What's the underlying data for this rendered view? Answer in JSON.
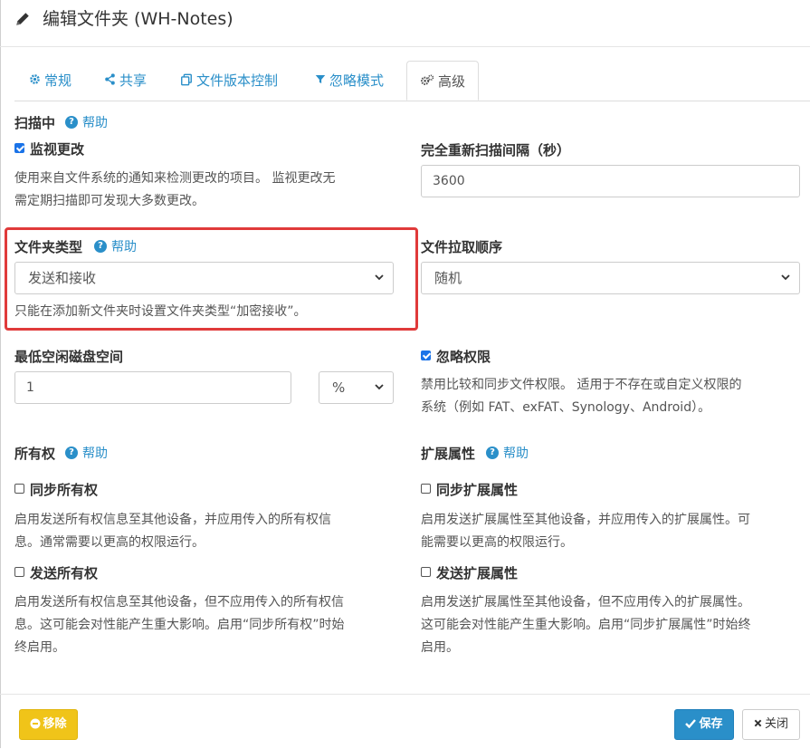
{
  "dialog": {
    "title": "编辑文件夹 (WH-Notes)"
  },
  "tabs": [
    {
      "label": "常规",
      "icon": "gear-icon"
    },
    {
      "label": "共享",
      "icon": "share-icon"
    },
    {
      "label": "文件版本控制",
      "icon": "copy-icon"
    },
    {
      "label": "忽略模式",
      "icon": "filter-icon"
    },
    {
      "label": "高级",
      "icon": "gears-icon",
      "active": true
    }
  ],
  "help_label": "帮助",
  "scanning": {
    "heading": "扫描中",
    "watch_label": "监视更改",
    "watch_checked": true,
    "watch_desc_line1": "使用来自文件系统的通知来检测更改的项目。 监视更改无",
    "watch_desc_line2": "需定期扫描即可发现大多数更改。",
    "rescan_label": "完全重新扫描间隔（秒）",
    "rescan_value": "3600"
  },
  "folder_type": {
    "label": "文件夹类型",
    "selected": "发送和接收",
    "note": "只能在添加新文件夹时设置文件夹类型“加密接收”。"
  },
  "pull_order": {
    "label": "文件拉取顺序",
    "selected": "随机"
  },
  "min_disk": {
    "label": "最低空闲磁盘空间",
    "value": "1",
    "unit": "%"
  },
  "ignore_perms": {
    "label": "忽略权限",
    "checked": true,
    "desc_line1": "禁用比较和同步文件权限。 适用于不存在或自定义权限的",
    "desc_line2": "系统（例如 FAT、exFAT、Synology、Android）。"
  },
  "ownership": {
    "heading": "所有权",
    "sync_label": "同步所有权",
    "sync_desc_line1": "启用发送所有权信息至其他设备，并应用传入的所有权信",
    "sync_desc_line2": "息。通常需要以更高的权限运行。",
    "send_label": "发送所有权",
    "send_desc_line1": "启用发送所有权信息至其他设备，但不应用传入的所有权信",
    "send_desc_line2": "息。这可能会对性能产生重大影响。启用“同步所有权”时始",
    "send_desc_line3": "终启用。"
  },
  "xattrs": {
    "heading": "扩展属性",
    "sync_label": "同步扩展属性",
    "sync_desc_line1": "启用发送扩展属性至其他设备，并应用传入的扩展属性。可",
    "sync_desc_line2": "能需要以更高的权限运行。",
    "send_label": "发送扩展属性",
    "send_desc_line1": "启用发送扩展属性至其他设备，但不应用传入的扩展属性。",
    "send_desc_line2": "这可能会对性能产生重大影响。启用“同步扩展属性”时始终",
    "send_desc_line3": "启用。"
  },
  "footer": {
    "remove": "移除",
    "save": "保存",
    "close": "关闭"
  },
  "colors": {
    "accent": "#2a8fc9",
    "warning": "#f0c419",
    "highlight": "#e03a3a"
  }
}
